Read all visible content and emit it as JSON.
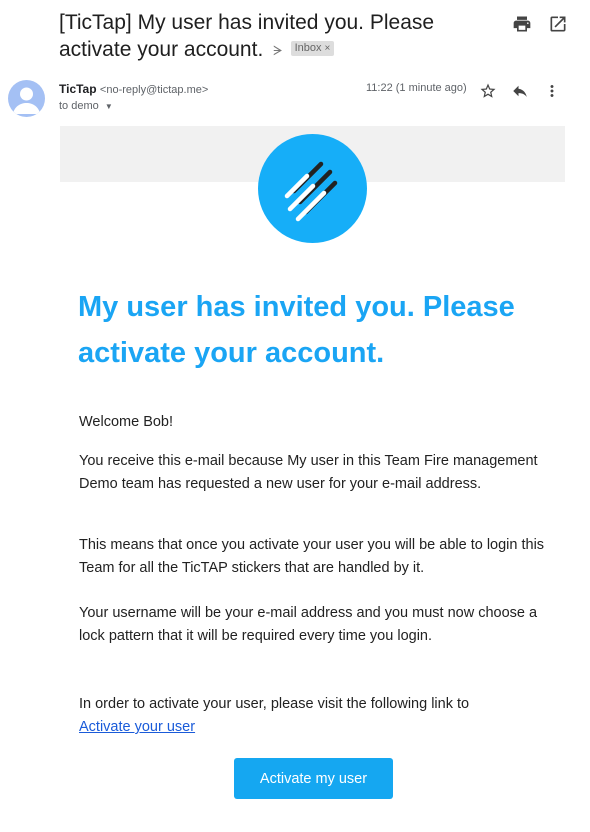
{
  "subject": {
    "title": "[TicTap] My user has invited you. Please activate your account.",
    "label": "Inbox",
    "label_close": "×"
  },
  "sender": {
    "name": "TicTap",
    "email": "<no-reply@tictap.me>",
    "to": "to demo",
    "time": "11:22 (1 minute ago)"
  },
  "email": {
    "heading": "My user has invited you. Please activate your account.",
    "greeting": "Welcome Bob!",
    "para1": "You receive this e-mail because My user in this Team Fire management Demo team has requested a new user for your e-mail address.",
    "para2": "This means that once you activate your user you will be able to login this Team for all the TicTAP stickers that are handled by it.",
    "para3": "Your username will be your e-mail address and you must now choose a lock pattern that it will be required every time you login.",
    "para4": "In order to activate your user, please visit the following link to",
    "link_text": "Activate your user",
    "button_label": "Activate my user"
  },
  "colors": {
    "accent": "#1aa5f4",
    "button": "#15a7f1",
    "link": "#1a5bd9",
    "logo": "#16aef8"
  },
  "icons": [
    "print-icon",
    "open-in-new-icon",
    "label-arrow-icon",
    "star-icon",
    "reply-icon",
    "more-vert-icon",
    "chevron-down-icon",
    "avatar-person-icon"
  ]
}
